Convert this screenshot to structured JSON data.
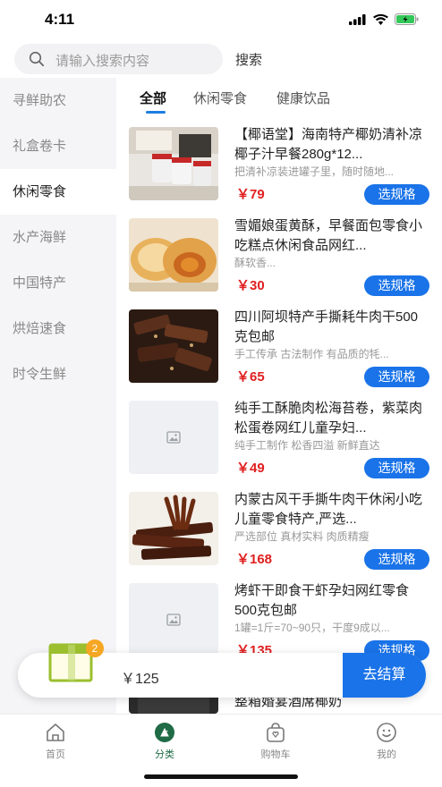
{
  "status": {
    "time": "4:11"
  },
  "search": {
    "placeholder": "请输入搜索内容",
    "button": "搜索"
  },
  "sidebar": {
    "items": [
      {
        "label": "寻鲜助农"
      },
      {
        "label": "礼盒卷卡"
      },
      {
        "label": "休闲零食",
        "active": true
      },
      {
        "label": "水产海鲜"
      },
      {
        "label": "中国特产"
      },
      {
        "label": "烘焙速食"
      },
      {
        "label": "时令生鲜"
      }
    ]
  },
  "tabs": [
    {
      "label": "全部",
      "active": true
    },
    {
      "label": "休闲零食"
    },
    {
      "label": "健康饮品"
    }
  ],
  "products": [
    {
      "title": "【椰语堂】海南特产椰奶清补凉椰子汁早餐280g*12...",
      "desc": "把清补凉装进罐子里，随时随地...",
      "price": "￥79",
      "button": "选规格",
      "image": "coconut-cans"
    },
    {
      "title": "雪媚娘蛋黄酥，早餐面包零食小吃糕点休闲食品网红...",
      "desc": "酥软香...",
      "price": "￥30",
      "button": "选规格",
      "image": "egg-yolk-pastry"
    },
    {
      "title": "四川阿坝特产手撕耗牛肉干500克包邮",
      "desc": "手工传承 古法制作 有品质的牦...",
      "price": "￥65",
      "button": "选规格",
      "image": "beef-jerky"
    },
    {
      "title": "纯手工酥脆肉松海苔卷，紫菜肉松蛋卷网红儿童孕妇...",
      "desc": "纯手工制作 松香四溢 新鲜直达",
      "price": "￥49",
      "button": "选规格",
      "image": "placeholder"
    },
    {
      "title": "内蒙古风干手撕牛肉干休闲小吃儿童零食特产,严选...",
      "desc": "严选部位 真材实料 肉质精瘦",
      "price": "￥168",
      "button": "选规格",
      "image": "dried-beef"
    },
    {
      "title": "烤虾干即食干虾孕妇网红零食500克包邮",
      "desc": "1罐=1斤=70~90只，干度9成以...",
      "price": "￥135",
      "button": "选规格",
      "image": "placeholder"
    },
    {
      "title": "整箱婚宴酒席椰奶",
      "desc": "",
      "price": "",
      "button": "",
      "image": "partial"
    }
  ],
  "cart": {
    "count": "2",
    "total": "￥125",
    "checkout": "去结算"
  },
  "tabbar": [
    {
      "label": "首页",
      "icon": "home-icon"
    },
    {
      "label": "分类",
      "icon": "category-icon",
      "active": true
    },
    {
      "label": "购物车",
      "icon": "cart-icon"
    },
    {
      "label": "我的",
      "icon": "profile-icon"
    }
  ],
  "colors": {
    "accent": "#1a73e8",
    "price": "#e02020",
    "active_tab": "#1f6b46",
    "badge": "#f5a623"
  }
}
